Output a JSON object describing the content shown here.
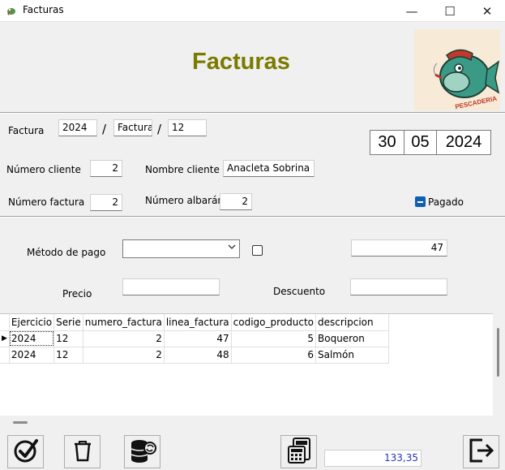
{
  "window": {
    "title": "Facturas",
    "minimize_glyph": "—",
    "maximize_glyph": "☐",
    "close_glyph": "✕"
  },
  "header": {
    "title": "Facturas",
    "logo_text": "PESCADERIA"
  },
  "form": {
    "factura_label": "Factura",
    "factura_year": "2024",
    "factura_series": "Factura",
    "factura_number": "12",
    "slash": "/",
    "date_day": "30",
    "date_month": "05",
    "date_year": "2024",
    "numero_cliente_label": "Número cliente",
    "numero_cliente_value": "2",
    "nombre_cliente_label": "Nombre cliente",
    "nombre_cliente_value": "Anacleta Sobrina",
    "numero_factura_label": "Número factura",
    "numero_factura_value": "2",
    "numero_albaran_label": "Número albarán",
    "numero_albaran_value": "2",
    "pagado_label": "Pagado",
    "pagado_state": "indeterminate"
  },
  "payment": {
    "metodo_pago_label": "Método de pago",
    "metodo_pago_value": "",
    "linea_value": "47",
    "precio_label": "Precio",
    "precio_value": "",
    "descuento_label": "Descuento",
    "descuento_value": ""
  },
  "grid": {
    "columns": [
      "Ejercicio",
      "Serie",
      "numero_factura",
      "linea_factura",
      "codigo_producto",
      "descripcion"
    ],
    "rows": [
      [
        "2024",
        "12",
        "2",
        "47",
        "5",
        "Boqueron"
      ],
      [
        "2024",
        "12",
        "2",
        "48",
        "6",
        "Salmón"
      ]
    ],
    "current_row_marker": "▶"
  },
  "toolbar": {
    "total": "133,35"
  },
  "icons": {
    "app": "fish-app-icon",
    "confirm": "check-circle-icon",
    "delete": "trash-icon",
    "refresh": "database-refresh-icon",
    "calculator": "calculator-icon",
    "exit": "exit-door-icon"
  },
  "colors": {
    "title": "#7a7a00",
    "checkbox": "#0e5fb4",
    "total_text": "#2633b8"
  }
}
